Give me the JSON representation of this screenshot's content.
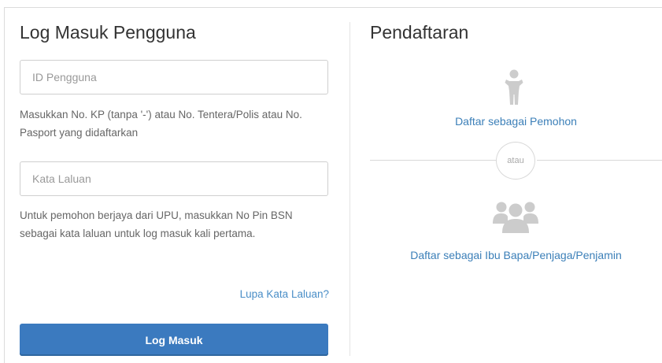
{
  "login": {
    "title": "Log Masuk Pengguna",
    "id_field": {
      "placeholder": "ID Pengguna",
      "value": ""
    },
    "id_help": "Masukkan No. KP (tanpa '-') atau No. Tentera/Polis atau No. Pasport yang didaftarkan",
    "password_field": {
      "placeholder": "Kata Laluan",
      "value": ""
    },
    "password_help": "Untuk pemohon berjaya dari UPU, masukkan No Pin BSN sebagai kata laluan untuk log masuk kali pertama.",
    "forgot_password": "Lupa Kata Laluan?",
    "submit_label": "Log Masuk"
  },
  "register": {
    "title": "Pendaftaran",
    "applicant_icon": "person-icon",
    "applicant_link": "Daftar sebagai Pemohon",
    "or_label": "atau",
    "parent_icon": "group-icon",
    "parent_link": "Daftar sebagai Ibu Bapa/Penjaga/Penjamin"
  },
  "colors": {
    "primary_button": "#3b7abf",
    "link": "#3b7fb8",
    "icon_gray": "#cccccc"
  }
}
